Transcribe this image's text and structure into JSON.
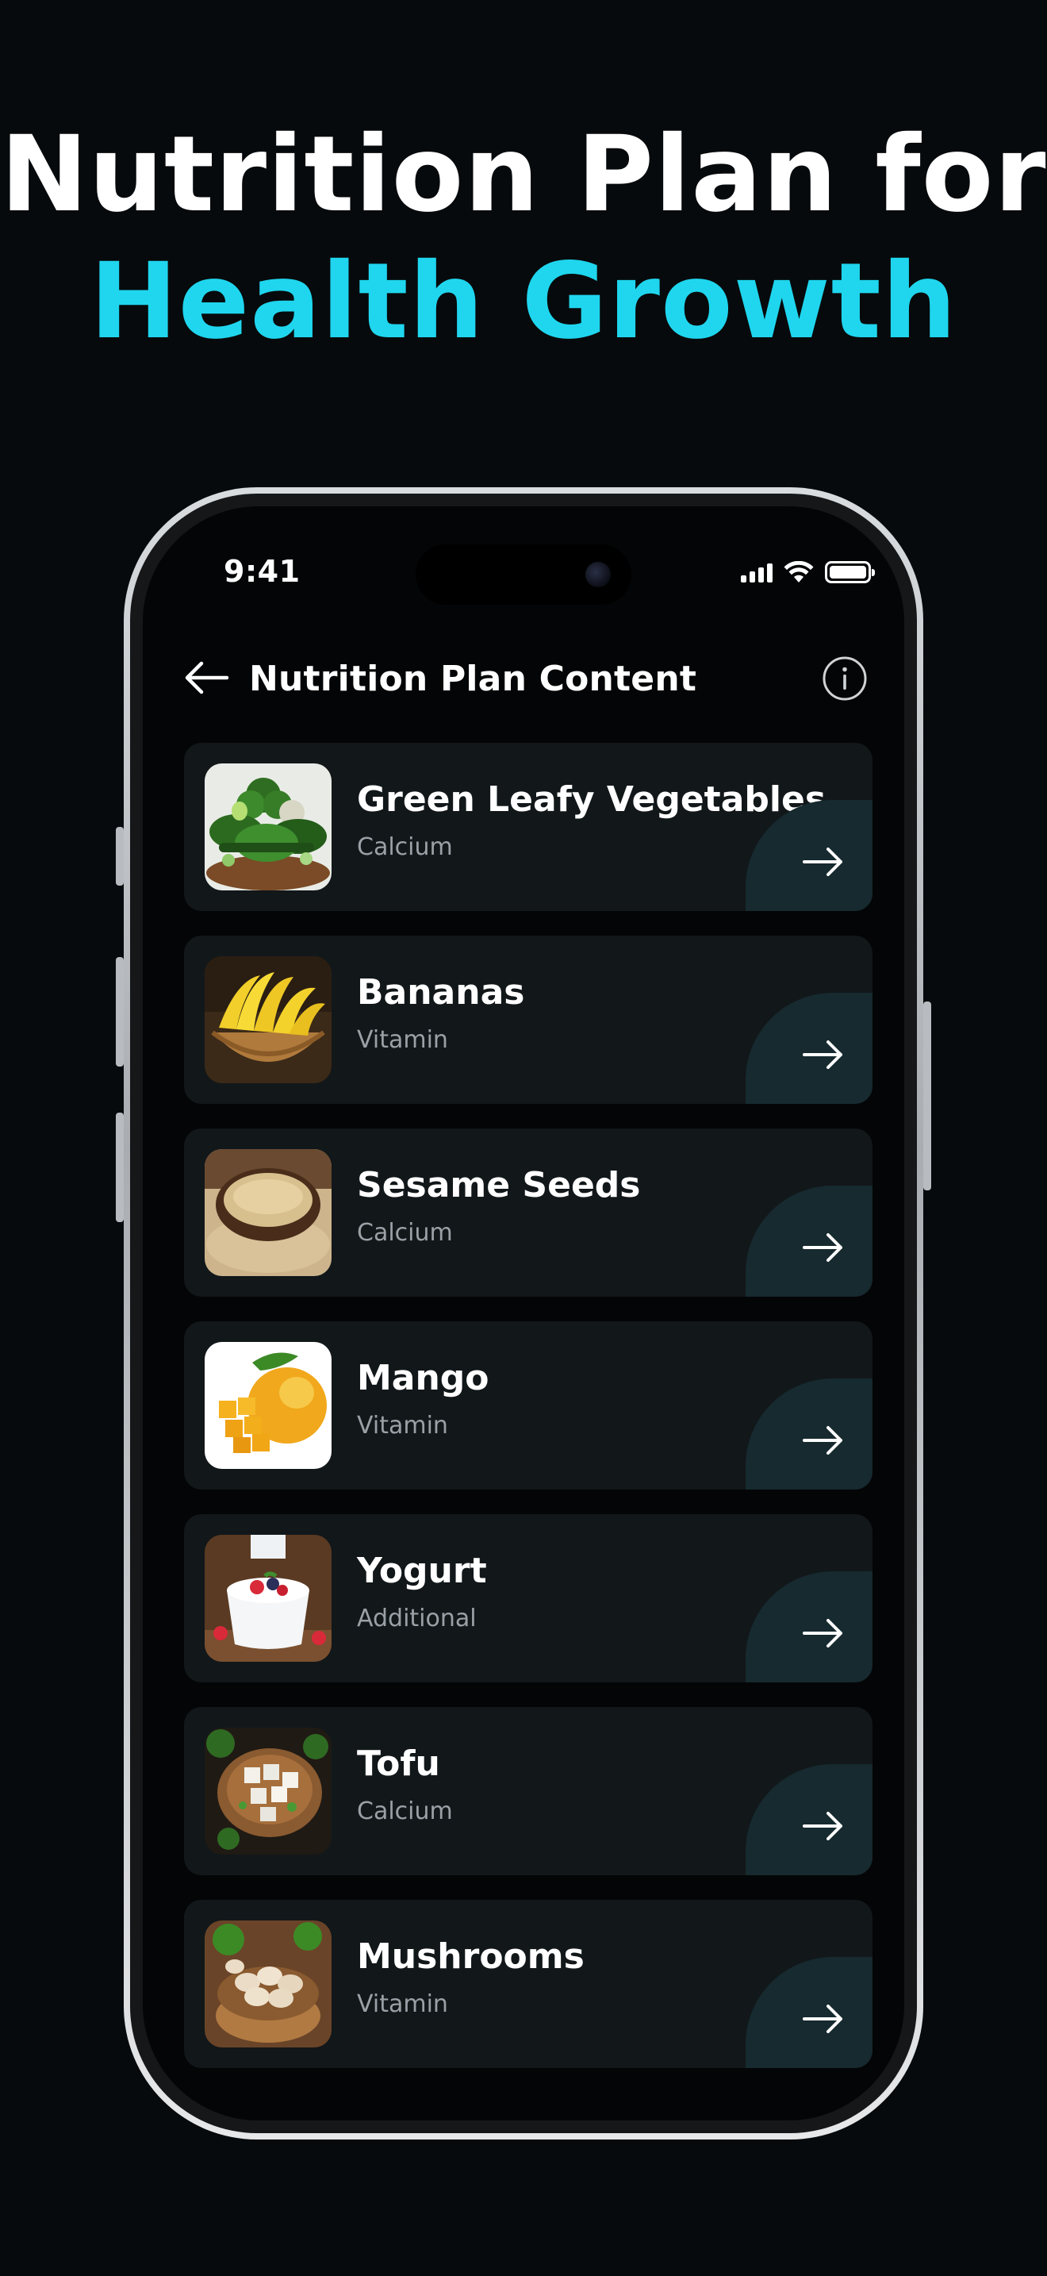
{
  "headline": {
    "line1": "Nutrition Plan for",
    "line2": "Health Growth"
  },
  "colors": {
    "accent": "#1fd6ee",
    "background": "#070a0c",
    "card": "#12171a",
    "subtitle": "#9aa1a6"
  },
  "status_bar": {
    "time": "9:41",
    "icons": [
      "signal-icon",
      "wifi-icon",
      "battery-icon"
    ]
  },
  "nav": {
    "back_icon": "arrow-left-icon",
    "title": "Nutrition Plan Content",
    "info_icon": "info-icon"
  },
  "items": [
    {
      "title": "Green Leafy Vegetables",
      "subtitle": "Calcium",
      "image": "leafy-vegetables-photo"
    },
    {
      "title": "Bananas",
      "subtitle": "Vitamin",
      "image": "bananas-photo"
    },
    {
      "title": "Sesame Seeds",
      "subtitle": "Calcium",
      "image": "sesame-seeds-photo"
    },
    {
      "title": "Mango",
      "subtitle": "Vitamin",
      "image": "mango-photo"
    },
    {
      "title": "Yogurt",
      "subtitle": "Additional",
      "image": "yogurt-photo"
    },
    {
      "title": "Tofu",
      "subtitle": "Calcium",
      "image": "tofu-photo"
    },
    {
      "title": "Mushrooms",
      "subtitle": "Vitamin",
      "image": "mushrooms-photo"
    }
  ]
}
